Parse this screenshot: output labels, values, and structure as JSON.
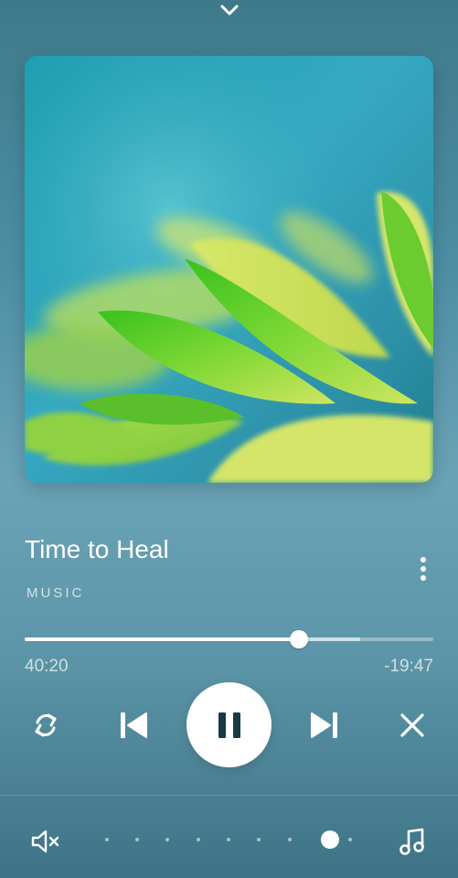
{
  "track": {
    "title": "Time to Heal",
    "category": "MUSIC"
  },
  "playback": {
    "elapsed": "40:20",
    "remaining": "-19:47",
    "progress_fraction": 0.672,
    "buffered_fraction": 0.82,
    "state": "playing"
  },
  "volume": {
    "level_fraction": 0.87,
    "dot_count": 9
  },
  "icons": {
    "collapse": "chevron-down-icon",
    "more": "more-vertical-icon",
    "repeat": "repeat-icon",
    "previous": "skip-previous-icon",
    "pause": "pause-icon",
    "next": "skip-next-icon",
    "close": "close-icon",
    "mute": "volume-mute-icon",
    "music": "music-note-icon"
  },
  "colors": {
    "background_top": "#3e7a8a",
    "background_mid": "#6aa3b6",
    "background_bottom": "#3d7385",
    "accent": "#ffffff",
    "play_icon": "#173a45"
  }
}
